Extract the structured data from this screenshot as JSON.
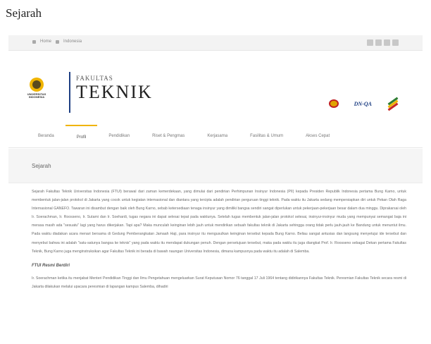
{
  "document": {
    "title": "Sejarah"
  },
  "topbar": {
    "home_label": "Home",
    "lang_label": "Indonesia"
  },
  "header": {
    "seal_text": "UNIVERSITAS INDONESIA",
    "brand_small": "FAKULTAS",
    "brand_big": "TEKNIK",
    "partner_2": "DN-QA"
  },
  "nav": {
    "items": [
      "Beranda",
      "Profil",
      "Pendidikan",
      "Riset & Pengmas",
      "Kerjasama",
      "Fasilitas & Umum",
      "Akses Cepat"
    ],
    "active_index": 1
  },
  "page": {
    "heading": "Sejarah"
  },
  "content": {
    "p1": "Sejarah Fakultas Teknik Universitas Indonesia (FTUI) berawal dari zaman kemerdekaan, yang dimulai dari pendirian Perhimpunan Insinyur Indonesia (PII) kepada Presiden Republik Indonesia pertama Bung Karno, untuk membentuk jalan-jalan protokol di Jakarta yang cocok untuk kegiatan internasional dan diantara yang tercipta adalah pendirian perguruan tinggi teknik. Pada waktu itu Jakarta sedang mempersiapkan diri untuk Pekan Olah Raga Internasional GANEFO. Tawaran ini disambut dengan baik oleh Bung Karno, sebab ketersediaan tenaga insinyur yang dimiliki bangsa sendiri sangat diperlukan untuk pekerjaan-pekerjaan besar dalam dua minggu. Diprakarsai oleh Ir. Soerachman, Ir. Roosseno, Ir. Sutami dan Ir. Soehardi, tugas negara ini dapat selesai tepat pada waktunya. Setelah tugas membentuk jalan-jalan protokol selesai, insinyur-insinyur muda yang mempunyai semangat baja ini merasa masih ada \"sesuatu\" lagi yang harus dikerjakan. Tapi apa? Maka munculah keinginan lebih jauh untuk mendirikan sebuah fakultas teknik di Jakarta sehingga orang tidak perlu jauh-jauh ke Bandung untuk menuntut ilmu. Pada waktu diadakan acara menari bersama di Gedung Pemberangkatan Jamaah Haji, para insinyur itu mengusulkan keinginan tersebut kepada Bung Karno. Beliau sangat antusias dan langsung menyetujui ide tersebut dan menyebut bahwa ini adalah \"satu-satunya bangsa ke teknis\" yang pada waktu itu mendapat dukungan penuh. Dengan persetujuan tersebut, maka pada waktu itu juga diangkat Prof. Ir. Roosseno sebagai Dekan pertama Fakultas Teknik, Bung Karno juga menginstruksikan agar Fakultas Teknik ini berada di bawah naungan Universitas Indonesia, dimana kampusnya pada waktu itu adalah di Salemba.",
    "subheading": "FTUI Resmi Berdiri",
    "p2": "Ir. Soerachman ketika itu menjabat Menteri Pendidikan Tinggi dan Ilmu Pengetahuan mengeluarkan Surat Keputusan Nomor 76 tanggal 17 Juli 1964 tentang didirikannya Fakultas Teknik. Peresmian Fakultas Teknik secara resmi di Jakarta dilakukan melalui upacara peresmian di lapangan kampus Salemba, dihadiri"
  }
}
